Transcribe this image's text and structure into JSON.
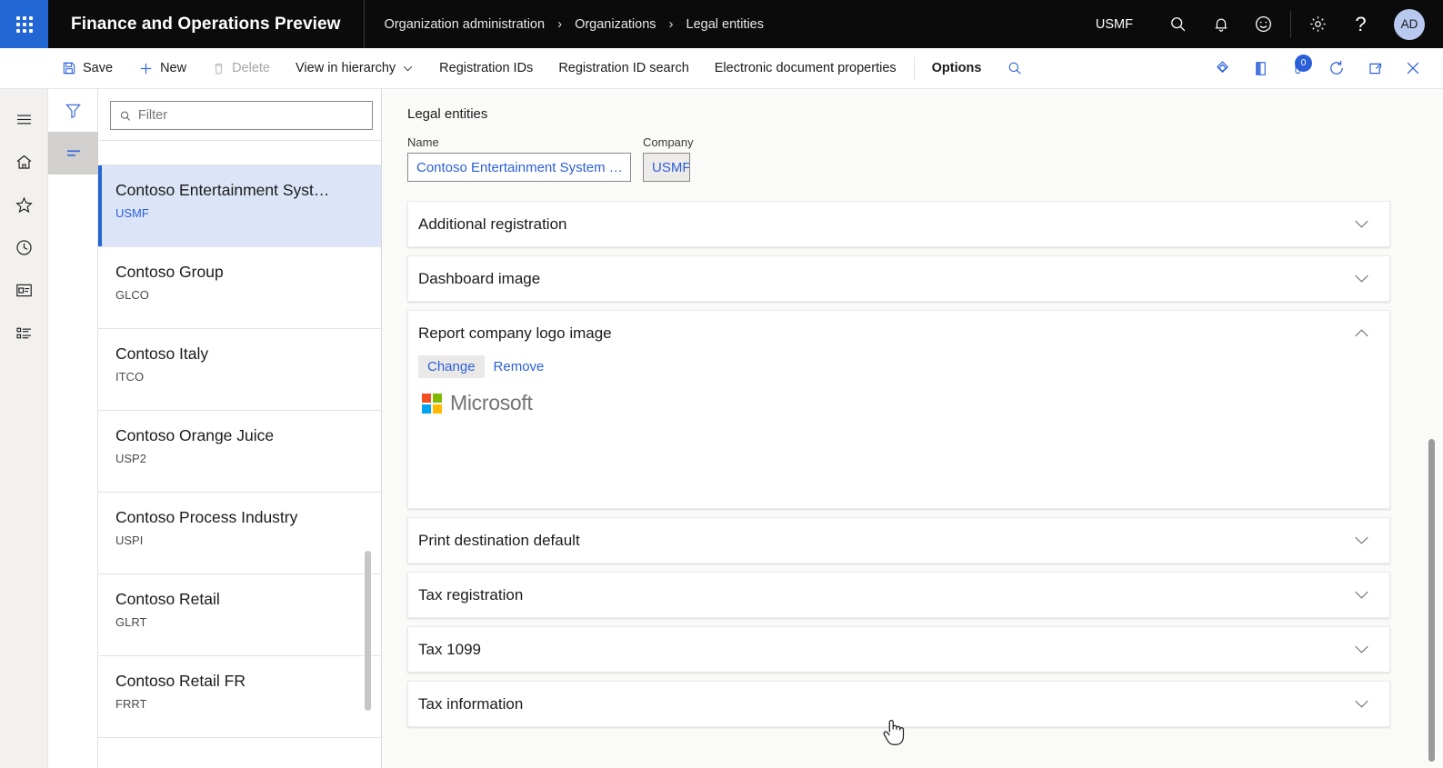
{
  "topnav": {
    "waffle_label": "App launcher",
    "app_title": "Finance and Operations Preview",
    "breadcrumb": [
      "Organization administration",
      "Organizations",
      "Legal entities"
    ],
    "chevron": "›",
    "company_code": "USMF",
    "icons": [
      "search-icon",
      "notifications-icon",
      "feedback-smiley-icon",
      "settings-gear-icon",
      "help-question-icon"
    ],
    "help_glyph": "?",
    "avatar_initials": "AD"
  },
  "actionbar": {
    "items": [
      {
        "label": "Save",
        "icon": "save-icon",
        "disabled": false,
        "bold": false
      },
      {
        "label": "New",
        "icon": "plus-icon",
        "disabled": false,
        "bold": false
      },
      {
        "label": "Delete",
        "icon": "trash-icon",
        "disabled": true,
        "bold": false
      },
      {
        "label": "View in hierarchy",
        "icon": "chevron-down-icon",
        "disabled": false,
        "bold": false
      },
      {
        "label": "Registration IDs",
        "icon": "",
        "disabled": false,
        "bold": false
      },
      {
        "label": "Registration ID search",
        "icon": "",
        "disabled": false,
        "bold": false
      },
      {
        "label": "Electronic document properties",
        "icon": "",
        "disabled": false,
        "bold": false
      },
      {
        "label": "Options",
        "icon": "",
        "disabled": false,
        "bold": true
      }
    ],
    "search_icon": "search-icon",
    "right_icons": [
      "attachments-diamond-icon",
      "panel-icon",
      "notes-icon",
      "refresh-icon",
      "open-in-new-icon",
      "close-icon"
    ],
    "badge_count": "0"
  },
  "rail": {
    "items": [
      {
        "name": "hamburger-menu-icon"
      },
      {
        "name": "home-icon"
      },
      {
        "name": "favorites-star-icon"
      },
      {
        "name": "recent-clock-icon"
      },
      {
        "name": "workspaces-icon"
      },
      {
        "name": "modules-list-icon"
      }
    ]
  },
  "filterpane": {
    "buttons": [
      {
        "name": "filter-funnel-icon",
        "active": false
      },
      {
        "name": "list-lines-icon",
        "active": true
      }
    ]
  },
  "list": {
    "filter_placeholder": "Filter",
    "filter_value": "",
    "search_icon": "search-icon",
    "items": [
      {
        "name": "Contoso Entertainment Syst…",
        "code": "USMF",
        "selected": true
      },
      {
        "name": "Contoso Group",
        "code": "GLCO",
        "selected": false
      },
      {
        "name": "Contoso Italy",
        "code": "ITCO",
        "selected": false
      },
      {
        "name": "Contoso Orange Juice",
        "code": "USP2",
        "selected": false
      },
      {
        "name": "Contoso Process Industry",
        "code": "USPI",
        "selected": false
      },
      {
        "name": "Contoso Retail",
        "code": "GLRT",
        "selected": false
      },
      {
        "name": "Contoso Retail FR",
        "code": "FRRT",
        "selected": false
      }
    ]
  },
  "main": {
    "form_caption": "Legal entities",
    "fields": [
      {
        "label": "Name",
        "value": "Contoso Entertainment System …"
      },
      {
        "label": "Company",
        "value": "USMF"
      }
    ],
    "sections": [
      {
        "title": "Additional registration",
        "expanded": false,
        "chevron": "⌄"
      },
      {
        "title": "Dashboard image",
        "expanded": false,
        "chevron": "⌄"
      },
      {
        "title": "Report company logo image",
        "expanded": true,
        "chevron": "⌃"
      },
      {
        "title": "Print destination default",
        "expanded": false,
        "chevron": "⌄"
      },
      {
        "title": "Tax registration",
        "expanded": false,
        "chevron": "⌄"
      },
      {
        "title": "Tax 1099",
        "expanded": false,
        "chevron": "⌄"
      },
      {
        "title": "Tax information",
        "expanded": false,
        "chevron": "⌄"
      }
    ],
    "logo_section": {
      "change_label": "Change",
      "remove_label": "Remove",
      "logo_word": "Microsoft",
      "logo_colors": [
        "#f25022",
        "#7fba00",
        "#00a4ef",
        "#ffb900"
      ]
    }
  },
  "colors": {
    "brand_blue": "#2266d4",
    "link_blue": "#2b5fd9",
    "topnav_bg": "#0b0b0b",
    "selected_row": "#dce5f7",
    "canvas": "#fafaf9"
  }
}
